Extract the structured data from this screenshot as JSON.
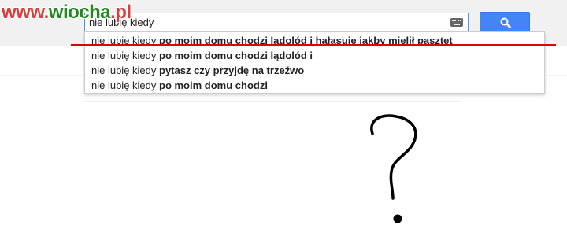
{
  "watermark": {
    "part1": "www.",
    "part2": "wiocha",
    "part3": ".pl"
  },
  "search": {
    "query": "nie lubię kiedy",
    "keyboard_icon": "keyboard-icon",
    "button_icon": "search-icon"
  },
  "suggestions": [
    {
      "prefix": "nie lubię kiedy ",
      "completion": "po moim domu chodzi lądolód i hałasuje jakby mielił pasztet"
    },
    {
      "prefix": "nie lubię kiedy ",
      "completion": "po moim domu chodzi lądolód i"
    },
    {
      "prefix": "nie lubię kiedy ",
      "completion": "pytasz czy przyjdę na trzeźwo"
    },
    {
      "prefix": "nie lubię kiedy ",
      "completion": "po moim domu chodzi"
    }
  ],
  "colors": {
    "highlight": "#e00000",
    "button": "#4285f4"
  },
  "drawing": "question-mark"
}
